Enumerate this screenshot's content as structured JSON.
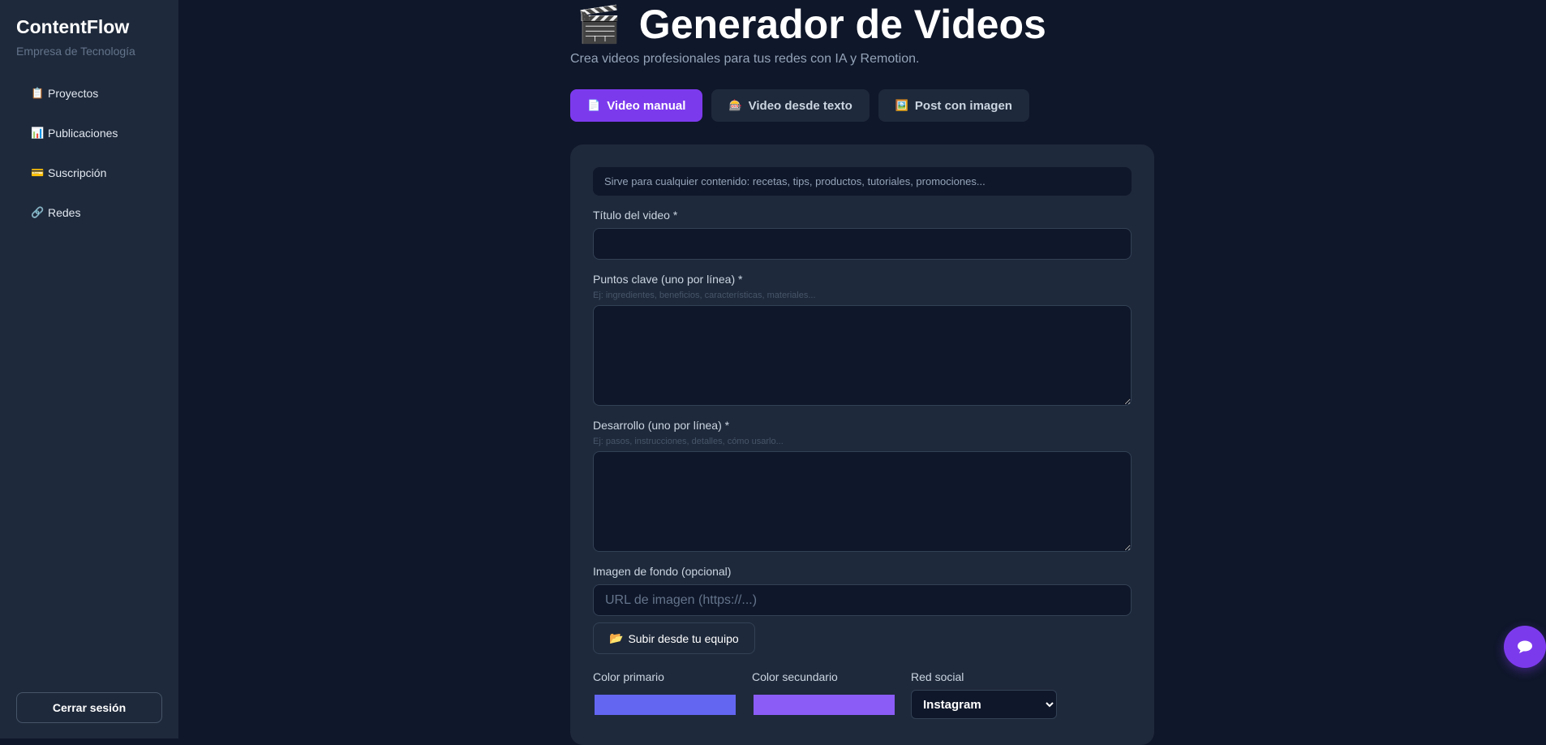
{
  "sidebar": {
    "brand": "ContentFlow",
    "company": "Empresa de Tecnología",
    "items": [
      {
        "icon": "📋",
        "label": "Proyectos"
      },
      {
        "icon": "📊",
        "label": "Publicaciones"
      },
      {
        "icon": "💳",
        "label": "Suscripción"
      },
      {
        "icon": "🔗",
        "label": "Redes"
      }
    ],
    "logout": "Cerrar sesión"
  },
  "header": {
    "icon": "🎬",
    "title": "Generador de Videos",
    "subtitle": "Crea videos profesionales para tus redes con IA y Remotion."
  },
  "tabs": [
    {
      "icon": "📄",
      "label": "Video manual",
      "active": true
    },
    {
      "icon": "🎰",
      "label": "Video desde texto",
      "active": false
    },
    {
      "icon": "🖼️",
      "label": "Post con imagen",
      "active": false
    }
  ],
  "form": {
    "info": "Sirve para cualquier contenido: recetas, tips, productos, tutoriales, promociones...",
    "title_label": "Título del video *",
    "title_value": "",
    "points_label": "Puntos clave (uno por línea) *",
    "points_hint": "Ej: ingredientes, beneficios, características, materiales...",
    "points_value": "",
    "dev_label": "Desarrollo (uno por línea) *",
    "dev_hint": "Ej: pasos, instrucciones, detalles, cómo usarlo...",
    "dev_value": "",
    "bg_label": "Imagen de fondo (opcional)",
    "bg_placeholder": "URL de imagen (https://...)",
    "upload_icon": "📂",
    "upload_label": "Subir desde tu equipo",
    "primary_label": "Color primario",
    "primary_color": "#6366f1",
    "secondary_label": "Color secundario",
    "secondary_color": "#8b5cf6",
    "network_label": "Red social",
    "network_selected": "Instagram"
  },
  "chat_icon": "chat-bubble-icon",
  "colors": {
    "accent": "#7c3aed",
    "background": "#0f172a",
    "panel": "#1e293b"
  }
}
